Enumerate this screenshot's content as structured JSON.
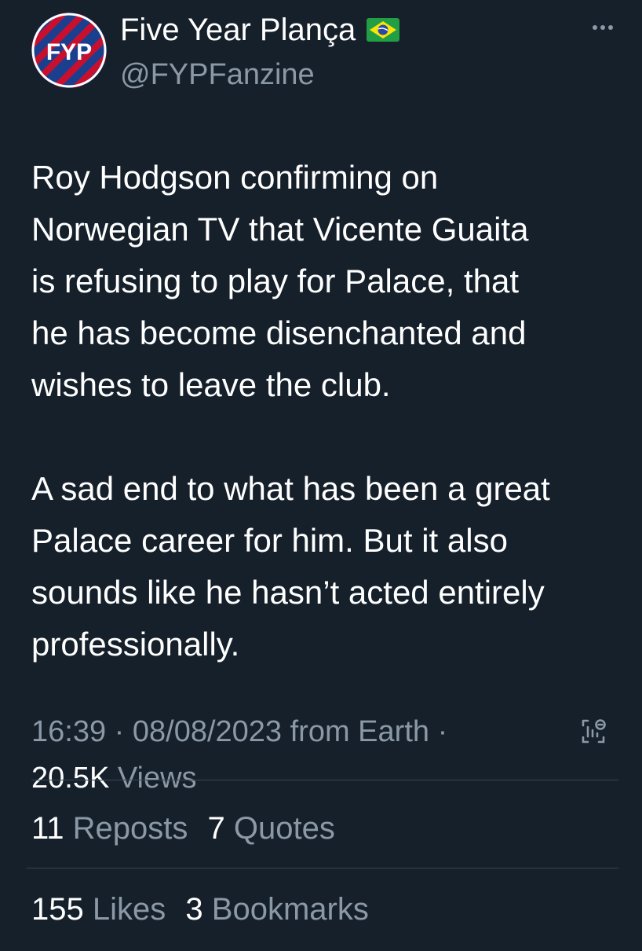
{
  "author": {
    "display_name": "Five Year Plança",
    "handle": "@FYPFanzine",
    "avatar_text": "FYP",
    "flag_icon": "brazil-flag-icon"
  },
  "tweet": {
    "paragraphs": [
      "Roy Hodgson confirming on\nNorwegian TV that Vicente Guaita\nis refusing to play for Palace, that\nhe has become disenchanted and\nwishes to leave the club.",
      "A sad end to what has been a great\nPalace career for him. But it also\nsounds like he hasn’t acted entirely\nprofessionally."
    ]
  },
  "meta": {
    "time": "16:39",
    "sep1": "·",
    "date": "08/08/2023",
    "source": "from Earth",
    "sep2": "·",
    "views_count": "20.5K",
    "views_label": "Views"
  },
  "stats": {
    "reposts_count": "11",
    "reposts_label": "Reposts",
    "quotes_count": "7",
    "quotes_label": "Quotes",
    "likes_count": "155",
    "likes_label": "Likes",
    "bookmarks_count": "3",
    "bookmarks_label": "Bookmarks"
  },
  "colors": {
    "background": "#15202b",
    "text_primary": "#ffffff",
    "text_secondary": "#8b98a5",
    "divider": "#38444d",
    "avatar_blue": "#1b3f8f",
    "avatar_red": "#c8102e"
  }
}
